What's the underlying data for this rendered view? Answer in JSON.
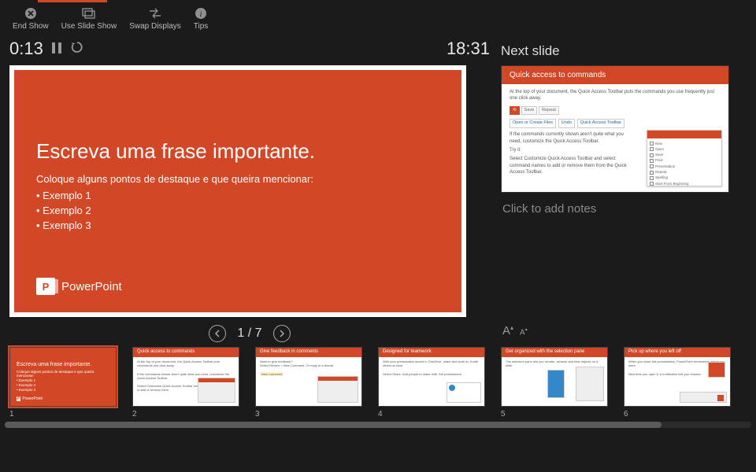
{
  "toolbar": {
    "end_show": "End Show",
    "use_slide_show": "Use Slide Show",
    "swap_displays": "Swap Displays",
    "tips": "Tips"
  },
  "timer": {
    "elapsed": "0:13",
    "clock": "18:31"
  },
  "current_slide": {
    "title": "Escreva uma frase importante.",
    "subtitle": "Coloque alguns pontos de destaque e que queira mencionar:",
    "bullets": [
      "•  Exemplo 1",
      "•  Exemplo 2",
      "•  Exemplo 3"
    ],
    "logo_text": "PowerPoint"
  },
  "slide_nav": {
    "counter": "1 / 7"
  },
  "right": {
    "next_label": "Next slide",
    "next_slide_title": "Quick access to commands",
    "next_body_1": "At the top of your document, the Quick Access Toolbar puts the commands you use frequently just one click away.",
    "next_body_2": "If the commands currently shown aren't quite what you need, customize the Quick Access Toolbar.",
    "next_try": "Try it:",
    "next_body_3": "Select Customize Quick Access Toolbar and select command names to add or remove them from the Quick Access Toolbar.",
    "notes_placeholder": "Click to add notes",
    "font_increase": "A",
    "font_decrease": "A"
  },
  "thumbnails": [
    {
      "num": "1",
      "title": "Escreva uma frase importante."
    },
    {
      "num": "2",
      "title": "Quick access to commands"
    },
    {
      "num": "3",
      "title": "Give feedback in comments"
    },
    {
      "num": "4",
      "title": "Designed for teamwork"
    },
    {
      "num": "5",
      "title": "Get organized with the selection pane"
    },
    {
      "num": "6",
      "title": "Pick up where you left off"
    }
  ]
}
